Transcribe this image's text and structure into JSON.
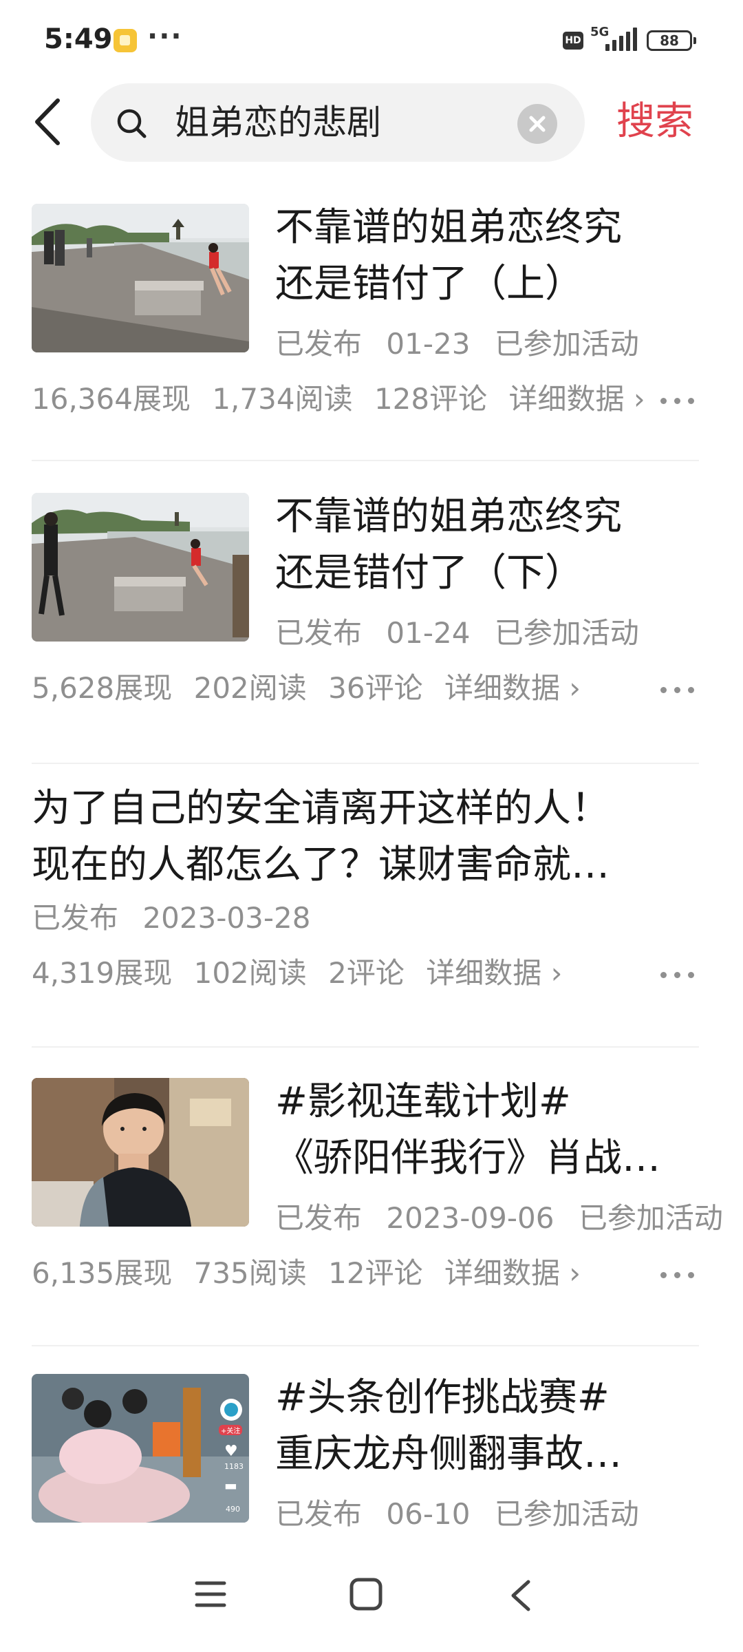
{
  "status_bar": {
    "time": "5:49",
    "dots": "···",
    "hd": "HD",
    "network": "5G",
    "battery": "88"
  },
  "search": {
    "query": "姐弟恋的悲剧",
    "submit_label": "搜索"
  },
  "items": [
    {
      "title_line1": "不靠谱的姐弟恋终究",
      "title_line2": "还是错付了（上）",
      "status": "已发布",
      "date": "01-23",
      "activity": "已参加活动",
      "impressions": "16,364展现",
      "reads": "1,734阅读",
      "comments": "128评论",
      "details": "详细数据 ›"
    },
    {
      "title_line1": "不靠谱的姐弟恋终究",
      "title_line2": "还是错付了（下）",
      "status": "已发布",
      "date": "01-24",
      "activity": "已参加活动",
      "impressions": "5,628展现",
      "reads": "202阅读",
      "comments": "36评论",
      "details": "详细数据 ›"
    },
    {
      "title_line1": "为了自己的安全请离开这样的人！",
      "title_line2": "现在的人都怎么了？谋财害命就…",
      "status": "已发布",
      "date": "2023-03-28",
      "impressions": "4,319展现",
      "reads": "102阅读",
      "comments": "2评论",
      "details": "详细数据 ›"
    },
    {
      "title_line1": "#影视连载计划#",
      "title_line2": "《骄阳伴我行》肖战…",
      "status": "已发布",
      "date": "2023-09-06",
      "activity": "已参加活动",
      "impressions": "6,135展现",
      "reads": "735阅读",
      "comments": "12评论",
      "details": "详细数据 ›"
    },
    {
      "title_line1": "#头条创作挑战赛#",
      "title_line2": "重庆龙舟侧翻事故…",
      "status": "已发布",
      "date": "06-10",
      "activity": "已参加活动",
      "thumb_like_count": "1183",
      "thumb_comment_count": "490",
      "thumb_follow": "+关注"
    }
  ],
  "colors": {
    "accent": "#e0424d",
    "meta_text": "#8f8f8f",
    "search_bg": "#f2f2f2"
  },
  "icons": {
    "back": "chevron-left-icon",
    "search": "magnifier-icon",
    "clear": "clear-x-icon",
    "more": "more-dots-icon",
    "nav": [
      "menu-icon",
      "home-square-icon",
      "back-chevron-icon"
    ]
  }
}
